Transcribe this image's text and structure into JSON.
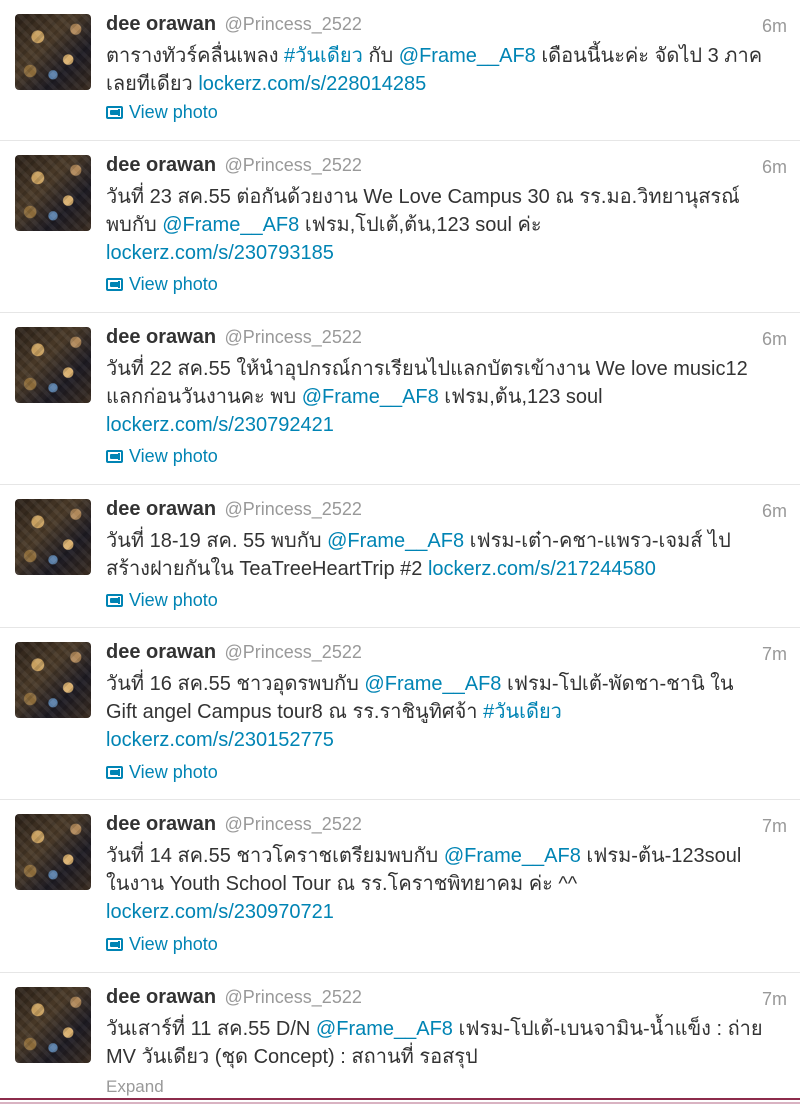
{
  "tweets": [
    {
      "name": "dee orawan",
      "handle": "@Princess_2522",
      "time": "6m",
      "segments": [
        {
          "t": "ตารางทัวร์คลื่นเพลง "
        },
        {
          "t": "#วันเดียว",
          "link": true
        },
        {
          "t": " กับ "
        },
        {
          "t": "@Frame__AF8",
          "link": true
        },
        {
          "t": " เดือนนี้นะค่ะ จัดไป 3 ภาคเลยทีเดียว "
        },
        {
          "t": "lockerz.com/s/228014285",
          "link": true
        }
      ],
      "action": "View photo"
    },
    {
      "name": "dee orawan",
      "handle": "@Princess_2522",
      "time": "6m",
      "segments": [
        {
          "t": "วันที่ 23 สค.55 ต่อกันด้วยงาน We Love Campus 30 ณ รร.มอ.วิทยานุสรณ์ พบกับ "
        },
        {
          "t": "@Frame__AF8",
          "link": true
        },
        {
          "t": " เฟรม,โปเต้,ต้น,123 soul ค่ะ "
        },
        {
          "t": "lockerz.com/s/230793185",
          "link": true
        }
      ],
      "action": "View photo"
    },
    {
      "name": "dee orawan",
      "handle": "@Princess_2522",
      "time": "6m",
      "segments": [
        {
          "t": "วันที่ 22 สค.55 ให้นำอุปกรณ์การเรียนไปแลกบัตรเข้างาน We love music12 แลกก่อนวันงานคะ พบ "
        },
        {
          "t": "@Frame__AF8",
          "link": true
        },
        {
          "t": " เฟรม,ต้น,123 soul "
        },
        {
          "t": "lockerz.com/s/230792421",
          "link": true
        }
      ],
      "action": "View photo"
    },
    {
      "name": "dee orawan",
      "handle": "@Princess_2522",
      "time": "6m",
      "segments": [
        {
          "t": "วันที่ 18-19 สค. 55 พบกับ "
        },
        {
          "t": "@Frame__AF8",
          "link": true
        },
        {
          "t": " เฟรม-เต๋า-คชา-แพรว-เจมส์ ไปสร้างฝายกันใน TeaTreeHeartTrip #2 "
        },
        {
          "t": "lockerz.com/s/217244580",
          "link": true
        }
      ],
      "action": "View photo"
    },
    {
      "name": "dee orawan",
      "handle": "@Princess_2522",
      "time": "7m",
      "segments": [
        {
          "t": "วันที่ 16 สค.55 ชาวอุดรพบกับ "
        },
        {
          "t": "@Frame__AF8",
          "link": true
        },
        {
          "t": " เฟรม-โปเต้-พัดชา-ชานิ ใน Gift angel Campus tour8 ณ รร.ราชินูทิศจ้า "
        },
        {
          "t": "#วันเดียว",
          "link": true
        },
        {
          "t": " "
        },
        {
          "t": "lockerz.com/s/230152775",
          "link": true
        }
      ],
      "action": "View photo"
    },
    {
      "name": "dee orawan",
      "handle": "@Princess_2522",
      "time": "7m",
      "segments": [
        {
          "t": "วันที่ 14 สค.55 ชาวโคราชเตรียมพบกับ "
        },
        {
          "t": "@Frame__AF8",
          "link": true
        },
        {
          "t": " เฟรม-ต้น-123soul ในงาน Youth School Tour ณ รร.โคราชพิทยาคม ค่ะ ^^ "
        },
        {
          "t": "lockerz.com/s/230970721",
          "link": true
        }
      ],
      "action": "View photo"
    },
    {
      "name": "dee orawan",
      "handle": "@Princess_2522",
      "time": "7m",
      "segments": [
        {
          "t": "วันเสาร์ที่ 11 สค.55 D/N "
        },
        {
          "t": "@Frame__AF8",
          "link": true
        },
        {
          "t": " เฟรม-โปเต้-เบนจามิน-น้ำแข็ง : ถ่าย MV วันเดียว (ชุด Concept) : สถานที่ รอสรุป"
        }
      ],
      "action": "Expand"
    }
  ]
}
